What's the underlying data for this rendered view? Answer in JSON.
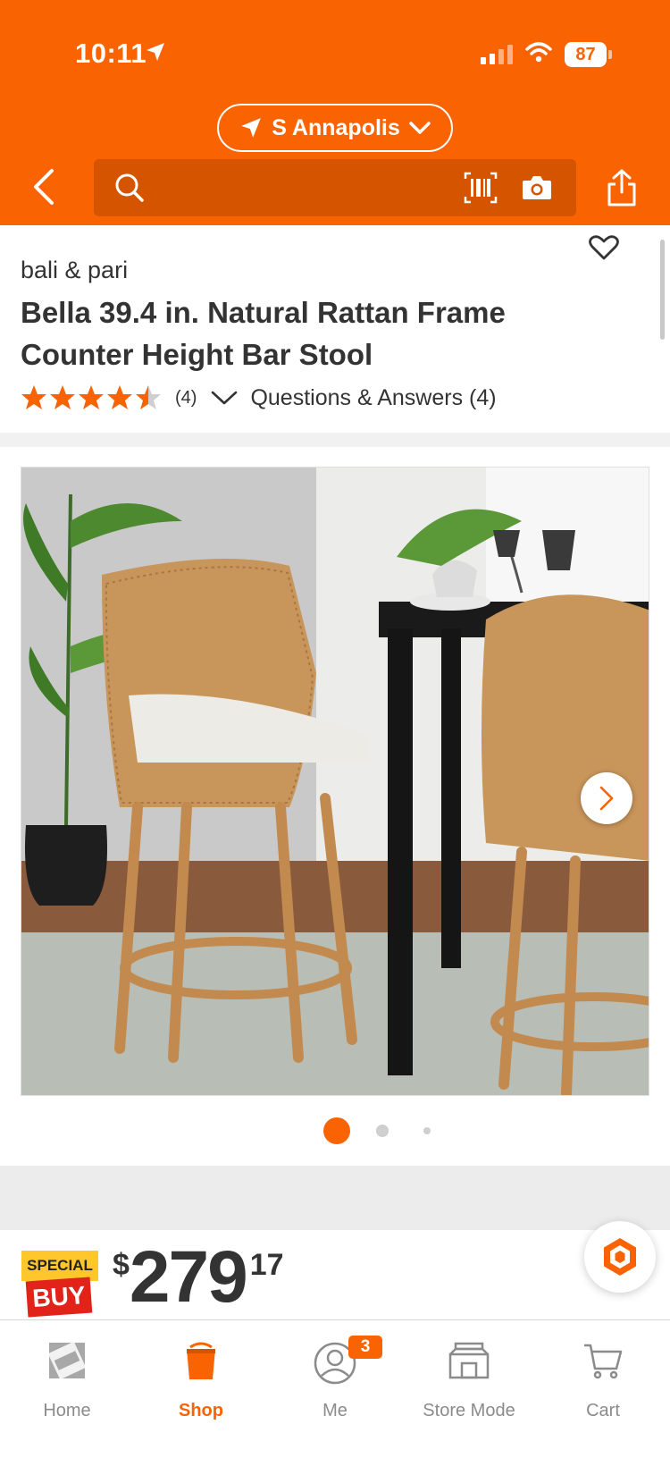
{
  "status_bar": {
    "time": "10:11",
    "battery": "87"
  },
  "header": {
    "store_location": "S Annapolis",
    "search_placeholder": ""
  },
  "product": {
    "brand": "bali & pari",
    "title": "Bella 39.4 in. Natural Rattan Frame Counter Height Bar Stool",
    "rating": 4.5,
    "review_count": "(4)",
    "qa_link": "Questions & Answers (4)"
  },
  "gallery": {
    "active_index": 0,
    "dot_count": 3
  },
  "pricing": {
    "badge_top": "SPECIAL",
    "badge_bottom": "BUY",
    "currency": "$",
    "dollars": "279",
    "cents": "17"
  },
  "tabbar": {
    "items": [
      {
        "label": "Home"
      },
      {
        "label": "Shop"
      },
      {
        "label": "Me",
        "badge": "3"
      },
      {
        "label": "Store Mode"
      },
      {
        "label": "Cart"
      }
    ],
    "active": "Shop"
  },
  "colors": {
    "brand_orange": "#f96302",
    "search_bg": "#d45400",
    "special_yellow": "#ffc72c",
    "special_red": "#e2231a"
  }
}
